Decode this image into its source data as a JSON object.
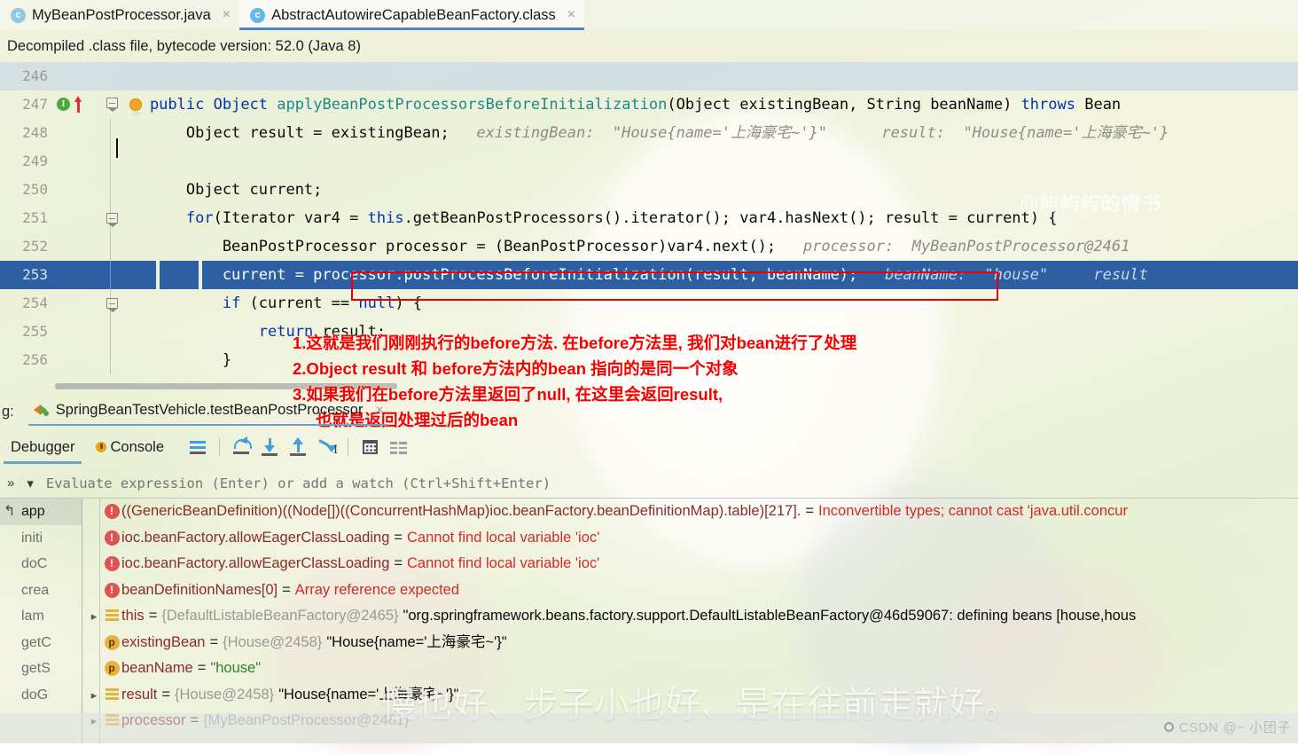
{
  "tabs": [
    {
      "label": "MyBeanPostProcessor.java",
      "icon": "java-class-icon",
      "active": false,
      "close": "×"
    },
    {
      "label": "AbstractAutowireCapableBeanFactory.class",
      "icon": "java-class-icon",
      "active": true,
      "close": "×"
    }
  ],
  "banner": {
    "text": "Decompiled .class file, bytecode version: 52.0 (Java 8)"
  },
  "editor": {
    "lines": [
      {
        "num": "246",
        "code": ""
      },
      {
        "num": "247",
        "code": "    public Object applyBeanPostProcessorsBeforeInitialization(Object existingBean, String beanName) throws Bean"
      },
      {
        "num": "248",
        "code": "        Object result = existingBean;",
        "hint": "existingBean:  \"House{name='上海豪宅~'}\"        result:  \"House{name='上海豪宅~'}"
      },
      {
        "num": "249",
        "code": ""
      },
      {
        "num": "250",
        "code": "        Object current;"
      },
      {
        "num": "251",
        "code": "        for(Iterator var4 = this.getBeanPostProcessors().iterator(); var4.hasNext(); result = current) {"
      },
      {
        "num": "252",
        "code": "            BeanPostProcessor processor = (BeanPostProcessor)var4.next();",
        "hint": "processor:  MyBeanPostProcessor@2461"
      },
      {
        "num": "253",
        "code": "            current = processor.postProcessBeforeInitialization(result, beanName);",
        "hint": "beanName:  \"house\"      result",
        "selected": true
      },
      {
        "num": "254",
        "code": "            if (current == null) {"
      },
      {
        "num": "255",
        "code": "                return result;"
      },
      {
        "num": "256",
        "code": "            }"
      }
    ]
  },
  "annotation": {
    "lines": [
      "1.这就是我们刚刚执行的before方法. 在before方法里, 我们对bean进行了处理",
      "2.Object result 和 before方法内的bean 指向的是同一个对象",
      "3.如果我们在before方法里返回了null, 在这里会返回result,",
      "也就是返回处理过后的bean"
    ],
    "color": "#f50000"
  },
  "debug": {
    "run_label": "g:",
    "run_config": "SpringBeanTestVehicle.testBeanPostProcessor",
    "run_close": "×",
    "tabs": [
      {
        "label": "Debugger",
        "selected": true
      },
      {
        "label": "Console",
        "selected": false
      }
    ],
    "toolbar": [
      {
        "name": "show-execution-point-icon"
      },
      {
        "name": "step-over-icon"
      },
      {
        "name": "step-into-icon"
      },
      {
        "name": "step-out-icon"
      },
      {
        "name": "run-to-cursor-icon"
      },
      {
        "name": "evaluate-expression-icon"
      },
      {
        "name": "layout-settings-icon"
      }
    ],
    "evaluate_placeholder": "Evaluate expression (Enter) or add a watch (Ctrl+Shift+Enter)",
    "frames": [
      {
        "label": "app",
        "current": true
      },
      {
        "label": "initi"
      },
      {
        "label": "doC"
      },
      {
        "label": "crea"
      },
      {
        "label": "lam"
      },
      {
        "label": "getC"
      },
      {
        "label": "getS"
      },
      {
        "label": "doG"
      }
    ],
    "variables": [
      {
        "icon": "error-icon",
        "expandable": false,
        "name": "((GenericBeanDefinition)((Node[])((ConcurrentHashMap)ioc.beanFactory.beanDefinitionMap).table)[217].",
        "eq": "=",
        "error": "Inconvertible types; cannot cast 'java.util.concur"
      },
      {
        "icon": "error-icon",
        "expandable": false,
        "name": "ioc.beanFactory.allowEagerClassLoading",
        "eq": "=",
        "error": "Cannot find local variable 'ioc'"
      },
      {
        "icon": "error-icon",
        "expandable": false,
        "name": "ioc.beanFactory.allowEagerClassLoading",
        "eq": "=",
        "error": "Cannot find local variable 'ioc'"
      },
      {
        "icon": "error-icon",
        "expandable": false,
        "name": "beanDefinitionNames[0]",
        "eq": "=",
        "error": "Array reference expected"
      },
      {
        "icon": "field-icon",
        "expandable": true,
        "name": "this",
        "eq": "=",
        "ref": "{DefaultListableBeanFactory@2465}",
        "value": "\"org.springframework.beans.factory.support.DefaultListableBeanFactory@46d59067: defining beans [house,hous"
      },
      {
        "icon": "param-icon",
        "expandable": false,
        "name": "existingBean",
        "eq": "=",
        "ref": "{House@2458}",
        "value": "\"House{name='上海豪宅~'}\""
      },
      {
        "icon": "param-icon",
        "expandable": false,
        "name": "beanName",
        "eq": "=",
        "strvalue": "\"house\""
      },
      {
        "icon": "field-icon",
        "expandable": true,
        "name": "result",
        "eq": "=",
        "ref": "{House@2458}",
        "value": "\"House{name='上海豪宅~'}\""
      },
      {
        "icon": "field-icon",
        "expandable": true,
        "name": "processor",
        "eq": "=",
        "ref": "{MyBeanPostProcessor@2461}"
      }
    ]
  },
  "watermarks": {
    "center": "慢也好、步子小也好、是在往前走就好。",
    "editor": "@屿屿屿的情书",
    "csdn": "CSDN @~ 小团子"
  },
  "colors": {
    "selection": "#2d5fa2",
    "redbox": "#ee0000",
    "annotation": "#f50000",
    "keyword": "#0033b3",
    "method": "#1a8a8a",
    "error_text": "#d12a2a",
    "var_name": "#8a2b2b"
  }
}
